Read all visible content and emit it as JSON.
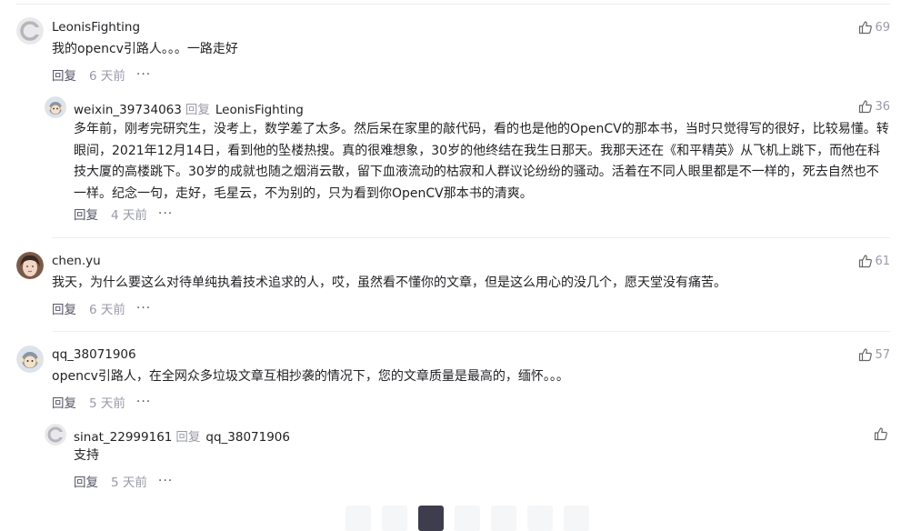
{
  "comments": [
    {
      "user": "LeonisFighting",
      "text": "我的opencv引路人。。。一路走好",
      "likes": "69",
      "reply_label": "回复",
      "time": "6 天前",
      "more": "···",
      "replies": [
        {
          "user": "weixin_39734063",
          "reply_kw": "回复",
          "reply_to": "LeonisFighting",
          "likes": "36",
          "text": "多年前，刚考完研究生，没考上，数学差了太多。然后呆在家里的敲代码，看的也是他的OpenCV的那本书，当时只觉得写的很好，比较易懂。转眼间，2021年12月14日，看到他的坠楼热搜。真的很难想象，30岁的他终结在我生日那天。我那天还在《和平精英》从飞机上跳下，而他在科技大厦的高楼跳下。30岁的成就也随之烟消云散，留下血液流动的枯寂和人群议论纷纷的骚动。活着在不同人眼里都是不一样的，死去自然也不一样。纪念一句，走好，毛星云，不为别的，只为看到你OpenCV那本书的清爽。",
          "reply_label": "回复",
          "time": "4 天前",
          "more": "···"
        }
      ]
    },
    {
      "user": "chen.yu",
      "text": "我天，为什么要这么对待单纯执着技术追求的人，哎，虽然看不懂你的文章，但是这么用心的没几个，愿天堂没有痛苦。",
      "likes": "61",
      "reply_label": "回复",
      "time": "6 天前",
      "more": "···"
    },
    {
      "user": "qq_38071906",
      "text": "opencv引路人，在全网众多垃圾文章互相抄袭的情况下，您的文章质量是最高的，缅怀。。。",
      "likes": "57",
      "reply_label": "回复",
      "time": "5 天前",
      "more": "···",
      "replies": [
        {
          "user": "sinat_22999161",
          "reply_kw": "回复",
          "reply_to": "qq_38071906",
          "likes": "",
          "text": "支持",
          "reply_label": "回复",
          "time": "5 天前",
          "more": "···"
        }
      ]
    }
  ],
  "colors": {
    "text": "#222226",
    "muted": "#999aaa",
    "action": "#555666",
    "active_page": "#3d3d4d"
  }
}
